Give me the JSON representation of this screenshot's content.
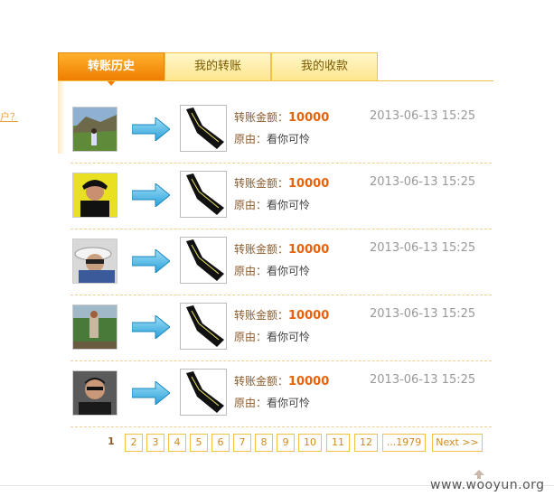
{
  "side_link": "户？",
  "tabs": [
    {
      "label": "转账历史",
      "active": true
    },
    {
      "label": "我的转账",
      "active": false
    },
    {
      "label": "我的收款",
      "active": false
    }
  ],
  "colors": {
    "accent": "#f07d00",
    "amount": "#e8620a",
    "border": "#f0c24a"
  },
  "transfers": [
    {
      "amount_label": "转账金额：",
      "amount": "10000",
      "date": "2013-06-13 15:25",
      "reason_label": "原由：",
      "reason": "看你可怜"
    },
    {
      "amount_label": "转账金额：",
      "amount": "10000",
      "date": "2013-06-13 15:25",
      "reason_label": "原由：",
      "reason": "看你可怜"
    },
    {
      "amount_label": "转账金额：",
      "amount": "10000",
      "date": "2013-06-13 15:25",
      "reason_label": "原由：",
      "reason": "看你可怜"
    },
    {
      "amount_label": "转账金额：",
      "amount": "10000",
      "date": "2013-06-13 15:25",
      "reason_label": "原由：",
      "reason": "看你可怜"
    },
    {
      "amount_label": "转账金额：",
      "amount": "10000",
      "date": "2013-06-13 15:25",
      "reason_label": "原由：",
      "reason": "看你可怜"
    }
  ],
  "pagination": {
    "current": "1",
    "pages": [
      "2",
      "3",
      "4",
      "5",
      "6",
      "7",
      "8",
      "9",
      "10",
      "11",
      "12",
      "...1979"
    ],
    "next": "Next >>"
  },
  "watermark": "www.wooyun.org"
}
